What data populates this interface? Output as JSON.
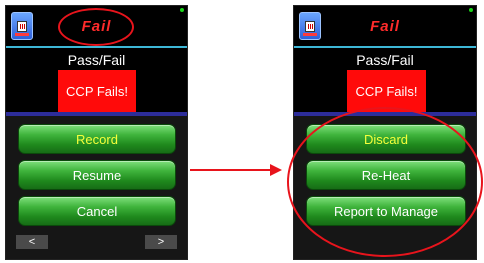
{
  "left_screen": {
    "title": "Fail",
    "subtitle": "Pass/Fail",
    "status": "CCP Fails!",
    "buttons": [
      "Record",
      "Resume",
      "Cancel"
    ],
    "nav_prev": "<",
    "nav_next": ">"
  },
  "right_screen": {
    "title": "Fail",
    "subtitle": "Pass/Fail",
    "status": "CCP Fails!",
    "buttons": [
      "Discard",
      "Re-Heat",
      "Report to Manage"
    ]
  },
  "colors": {
    "accent_red": "#ff2b2b",
    "button_green": "#2aa02a",
    "highlight_yellow": "#f6ff3b",
    "divider_cyan": "#3db7d6"
  },
  "icons": [
    "thermometer-probe-icon",
    "status-led-icon",
    "right-arrow-icon"
  ]
}
